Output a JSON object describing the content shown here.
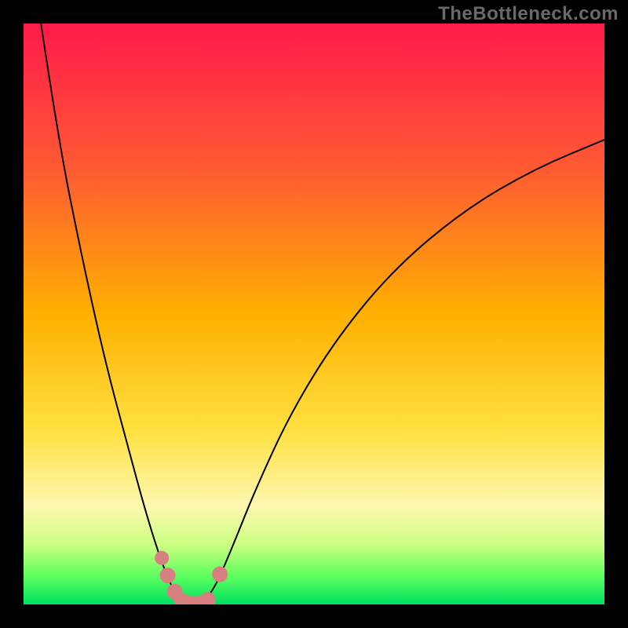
{
  "watermark": "TheBottleneck.com",
  "chart_data": {
    "type": "line",
    "title": "",
    "xlabel": "",
    "ylabel": "",
    "xlim": [
      0,
      100
    ],
    "ylim": [
      0,
      100
    ],
    "gradient_stops": [
      {
        "offset": 0,
        "color": "#ff1a4a"
      },
      {
        "offset": 25,
        "color": "#ff5a33"
      },
      {
        "offset": 50,
        "color": "#ffb000"
      },
      {
        "offset": 70,
        "color": "#ffe040"
      },
      {
        "offset": 83,
        "color": "#fff8b0"
      },
      {
        "offset": 90,
        "color": "#c8ff80"
      },
      {
        "offset": 95,
        "color": "#5fff5f"
      },
      {
        "offset": 100,
        "color": "#00e060"
      }
    ],
    "series": [
      {
        "name": "bottleneck-curve",
        "color": "#000000",
        "stroke_width": 2,
        "points": [
          {
            "x": 3,
            "y": 100
          },
          {
            "x": 6,
            "y": 80
          },
          {
            "x": 10,
            "y": 60
          },
          {
            "x": 14,
            "y": 42
          },
          {
            "x": 18,
            "y": 27
          },
          {
            "x": 21,
            "y": 16
          },
          {
            "x": 23.5,
            "y": 8
          },
          {
            "x": 25.5,
            "y": 3
          },
          {
            "x": 27,
            "y": 0.5
          },
          {
            "x": 29,
            "y": 0
          },
          {
            "x": 31,
            "y": 0.5
          },
          {
            "x": 33,
            "y": 3
          },
          {
            "x": 36,
            "y": 10
          },
          {
            "x": 40,
            "y": 20
          },
          {
            "x": 46,
            "y": 33
          },
          {
            "x": 54,
            "y": 46
          },
          {
            "x": 64,
            "y": 58
          },
          {
            "x": 76,
            "y": 68
          },
          {
            "x": 88,
            "y": 75
          },
          {
            "x": 100,
            "y": 80
          }
        ]
      }
    ],
    "annotations": [
      {
        "name": "marker-left-1",
        "x": 23.8,
        "y": 8,
        "color": "#d78080",
        "size": 9
      },
      {
        "name": "marker-left-2",
        "x": 24.8,
        "y": 5,
        "color": "#d78080",
        "size": 10
      },
      {
        "name": "marker-left-3",
        "x": 26.0,
        "y": 2.2,
        "color": "#d78080",
        "size": 10
      },
      {
        "name": "marker-bottom-1",
        "x": 27.3,
        "y": 0.6,
        "color": "#d78080",
        "size": 10
      },
      {
        "name": "marker-bottom-2",
        "x": 28.8,
        "y": 0.2,
        "color": "#d78080",
        "size": 10
      },
      {
        "name": "marker-bottom-3",
        "x": 30.3,
        "y": 0.2,
        "color": "#d78080",
        "size": 10
      },
      {
        "name": "marker-bottom-4",
        "x": 31.7,
        "y": 0.8,
        "color": "#d78080",
        "size": 10
      },
      {
        "name": "marker-right-1",
        "x": 33.8,
        "y": 5.2,
        "color": "#d78080",
        "size": 10
      }
    ]
  }
}
